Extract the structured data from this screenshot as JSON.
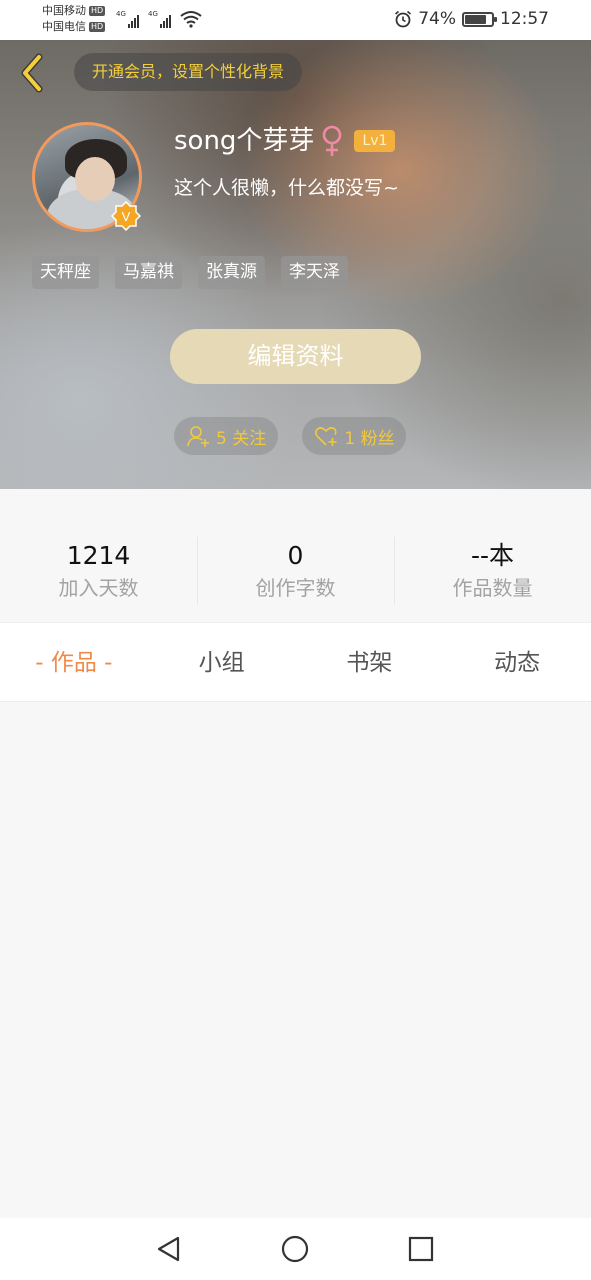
{
  "status_bar": {
    "carrier_1": "中国移动",
    "carrier_2": "中国电信",
    "hd_label": "HD",
    "network_1": "4G",
    "network_2": "4G",
    "battery_percent": "74%",
    "battery_level": 0.74,
    "time": "12:57"
  },
  "header": {
    "vip_prompt": "开通会员，设置个性化背景",
    "username": "song个芽芽",
    "gender_symbol": "female",
    "level": "Lv1",
    "bio": "这个人很懒，什么都没写~",
    "verified_badge": "V",
    "tags": [
      "天秤座",
      "马嘉祺",
      "张真源",
      "李天泽"
    ],
    "edit_button": "编辑资料",
    "following": "5 关注",
    "followers": "1 粉丝"
  },
  "stats": [
    {
      "value": "1214",
      "label": "加入天数"
    },
    {
      "value": "0",
      "label": "创作字数"
    },
    {
      "value": "--本",
      "label": "作品数量"
    }
  ],
  "tabs": [
    {
      "label": "- 作品 -",
      "active": true
    },
    {
      "label": "小组",
      "active": false
    },
    {
      "label": "书架",
      "active": false
    },
    {
      "label": "动态",
      "active": false
    }
  ],
  "colors": {
    "accent_orange": "#f08a4b",
    "vip_yellow": "#f3d03a",
    "level_badge": "#f3b03c",
    "edit_button": "#e6d9b5"
  },
  "icons": {
    "back": "chevron-left-icon",
    "gender": "female-icon",
    "follow": "person-add-icon",
    "fans": "heart-add-icon",
    "nav_back": "triangle-back-icon",
    "nav_home": "circle-home-icon",
    "nav_recent": "square-recent-icon"
  }
}
